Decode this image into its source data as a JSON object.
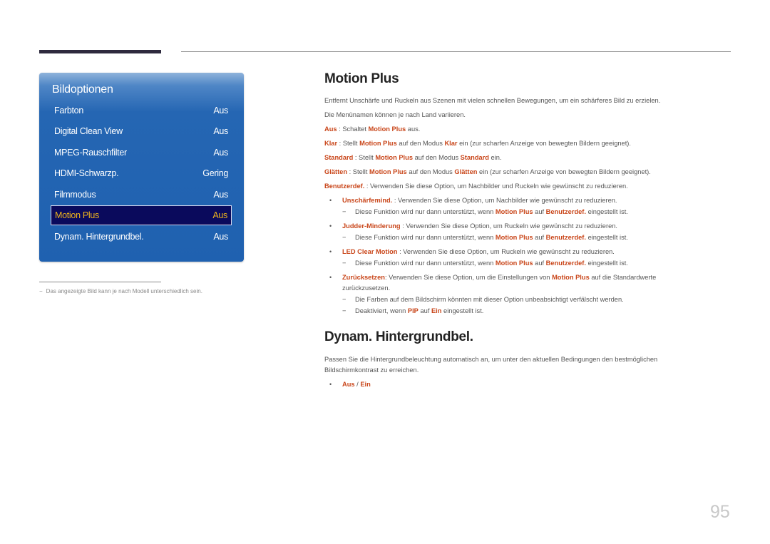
{
  "menu": {
    "title": "Bildoptionen",
    "items": [
      {
        "label": "Farbton",
        "value": "Aus",
        "selected": false
      },
      {
        "label": "Digital Clean View",
        "value": "Aus",
        "selected": false
      },
      {
        "label": "MPEG-Rauschfilter",
        "value": "Aus",
        "selected": false
      },
      {
        "label": "HDMI-Schwarzp.",
        "value": "Gering",
        "selected": false
      },
      {
        "label": "Filmmodus",
        "value": "Aus",
        "selected": false
      },
      {
        "label": "Motion Plus",
        "value": "Aus",
        "selected": true
      },
      {
        "label": "Dynam. Hintergrundbel.",
        "value": "Aus",
        "selected": false
      }
    ]
  },
  "footnote": {
    "dash": "−",
    "text": "Das angezeigte Bild kann je nach Modell unterschiedlich sein."
  },
  "colors": {
    "highlight": "#c9461a",
    "menu_blue": "#1f61b0",
    "menu_selected_bg": "#0a0a5c",
    "menu_selected_text": "#f0b51c"
  },
  "motion_plus": {
    "heading": "Motion Plus",
    "intro": "Entfernt Unschärfe und Ruckeln aus Szenen mit vielen schnellen Bewegungen, um ein schärferes Bild zu erzielen.",
    "note": "Die Menünamen können je nach Land variieren.",
    "options": {
      "aus": {
        "term": "Aus",
        "t1": " : Schaltet ",
        "ref": "Motion Plus",
        "t2": " aus."
      },
      "klar": {
        "term": "Klar",
        "t1": " : Stellt ",
        "ref": "Motion Plus",
        "t2": " auf den Modus ",
        "ref2": "Klar",
        "t3": " ein (zur scharfen Anzeige von bewegten Bildern geeignet)."
      },
      "standard": {
        "term": "Standard",
        "t1": " : Stellt ",
        "ref": "Motion Plus",
        "t2": " auf den Modus ",
        "ref2": "Standard",
        "t3": " ein."
      },
      "glaetten": {
        "term": "Glätten",
        "t1": " : Stellt ",
        "ref": "Motion Plus",
        "t2": " auf den Modus ",
        "ref2": "Glätten",
        "t3": " ein (zur scharfen Anzeige von bewegten Bildern geeignet)."
      },
      "benutzerdef": {
        "term": "Benutzerdef.",
        "t1": " : Verwenden Sie diese Option, um Nachbilder und Ruckeln wie gewünscht zu reduzieren."
      }
    },
    "bullets": {
      "bullet_char": "•",
      "dash_char": "−",
      "unschaerfe": {
        "term": "Unschärfemind.",
        "text": " : Verwenden Sie diese Option, um Nachbilder wie gewünscht zu reduzieren."
      },
      "judder": {
        "term": "Judder-Minderung",
        "text": " : Verwenden Sie diese Option, um Ruckeln wie gewünscht zu reduzieren."
      },
      "led": {
        "term": "LED Clear Motion",
        "text": " : Verwenden Sie diese Option, um Ruckeln wie gewünscht zu reduzieren."
      },
      "reset": {
        "term": "Zurücksetzen",
        "t1": ": Verwenden Sie diese Option, um die Einstellungen von ",
        "ref": "Motion Plus",
        "t2": " auf die Standardwerte zurückzusetzen."
      },
      "support_note": {
        "t1": "Diese Funktion wird nur dann unterstützt, wenn ",
        "ref": "Motion Plus",
        "t2": " auf ",
        "ref2": "Benutzerdef.",
        "t3": " eingestellt ist."
      },
      "reset_note1": "Die Farben auf dem Bildschirm könnten mit dieser Option unbeabsichtigt verfälscht werden.",
      "reset_note2": {
        "t1": "Deaktiviert, wenn ",
        "ref": "PIP",
        "t2": " auf ",
        "ref2": "Ein",
        "t3": " eingestellt ist."
      }
    }
  },
  "dynam": {
    "heading": "Dynam. Hintergrundbel.",
    "text": "Passen Sie die Hintergrundbeleuchtung automatisch an, um unter den aktuellen Bedingungen den bestmöglichen Bildschirmkontrast zu erreichen.",
    "option_aus": "Aus",
    "option_sep": " / ",
    "option_ein": "Ein"
  },
  "page_number": "95"
}
